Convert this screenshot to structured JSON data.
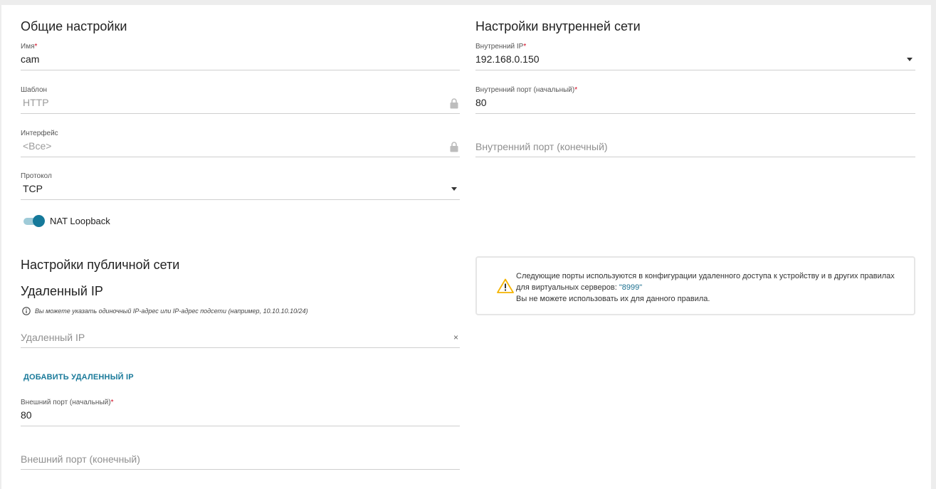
{
  "general": {
    "title": "Общие настройки",
    "name_label": "Имя",
    "name_value": "cam",
    "template_label": "Шаблон",
    "template_value": "HTTP",
    "interface_label": "Интерфейс",
    "interface_value": "<Все>",
    "protocol_label": "Протокол",
    "protocol_value": "TCP",
    "nat_loopback_label": "NAT Loopback",
    "nat_loopback_on": true
  },
  "internal": {
    "title": "Настройки внутренней сети",
    "ip_label": "Внутренний IP",
    "ip_value": "192.168.0.150",
    "port_start_label": "Внутренний порт (начальный)",
    "port_start_value": "80",
    "port_end_placeholder": "Внутренний порт (конечный)"
  },
  "public": {
    "title": "Настройки публичной сети",
    "remote_ip_title": "Удаленный IP",
    "hint": "Вы можете указать одиночный IP-адрес или IP-адрес подсети (например, 10.10.10.10/24)",
    "remote_ip_placeholder": "Удаленный IP",
    "add_remote_ip": "ДОБАВИТЬ УДАЛЕННЫЙ IP",
    "ext_port_start_label": "Внешний порт (начальный)",
    "ext_port_start_value": "80",
    "ext_port_end_placeholder": "Внешний порт (конечный)"
  },
  "notice": {
    "line1": "Следующие порты используются в конфигурации удаленного доступа к устройству и в других правилах",
    "line2_prefix": "для виртуальных серверов: ",
    "ports": "\"8999\"",
    "line3": "Вы не можете использовать их для данного правила."
  },
  "required_mark": "*",
  "clear_glyph": "×",
  "colors": {
    "accent": "#15799a",
    "required": "#d0021b",
    "warning": "#f5b400"
  }
}
